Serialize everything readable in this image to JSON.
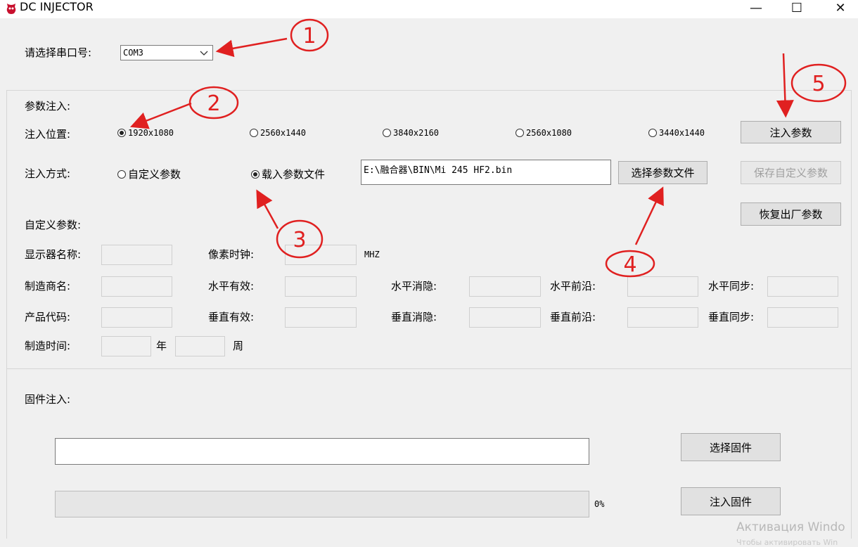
{
  "window": {
    "title": "DC INJECTOR",
    "controls": {
      "minimize": "—",
      "maximize": "☐",
      "close": "✕"
    }
  },
  "port": {
    "label": "请选择串口号:",
    "value": "COM3"
  },
  "params": {
    "group_label": "参数注入:",
    "position_label": "注入位置:",
    "positions": [
      {
        "label": "1920x1080",
        "selected": true
      },
      {
        "label": "2560x1440",
        "selected": false
      },
      {
        "label": "3840x2160",
        "selected": false
      },
      {
        "label": "2560x1080",
        "selected": false
      },
      {
        "label": "3440x1440",
        "selected": false
      }
    ],
    "method_label": "注入方式:",
    "methods": [
      {
        "label": "自定义参数",
        "selected": false
      },
      {
        "label": "载入参数文件",
        "selected": true
      }
    ],
    "file_path": "E:\\融合器\\BIN\\Mi 245 HF2.bin",
    "select_file_button": "选择参数文件",
    "inject_button": "注入参数",
    "save_custom_button": "保存自定义参数",
    "restore_factory_button": "恢复出厂参数"
  },
  "custom": {
    "title": "自定义参数:",
    "monitor_name": "显示器名称:",
    "pixel_clock": "像素时钟:",
    "mhz": "MHZ",
    "manufacturer": "制造商名:",
    "product_code": "产品代码:",
    "manufacture_time": "制造时间:",
    "year": "年",
    "week": "周",
    "h_active": "水平有效:",
    "h_blank": "水平消隐:",
    "h_front": "水平前沿:",
    "h_sync": "水平同步:",
    "v_active": "垂直有效:",
    "v_blank": "垂直消隐:",
    "v_front": "垂直前沿:",
    "v_sync": "垂直同步:"
  },
  "firmware": {
    "label": "固件注入:",
    "path": "",
    "select_button": "选择固件",
    "inject_button": "注入固件",
    "progress": 0,
    "progress_text": "0%"
  },
  "watermark": {
    "line1": "Активация Windo",
    "line2": "Чтобы активировать Win"
  },
  "annotations": [
    "1",
    "2",
    "3",
    "4",
    "5"
  ],
  "colors": {
    "annotation": "#e02020",
    "accent": "#c8102e"
  }
}
